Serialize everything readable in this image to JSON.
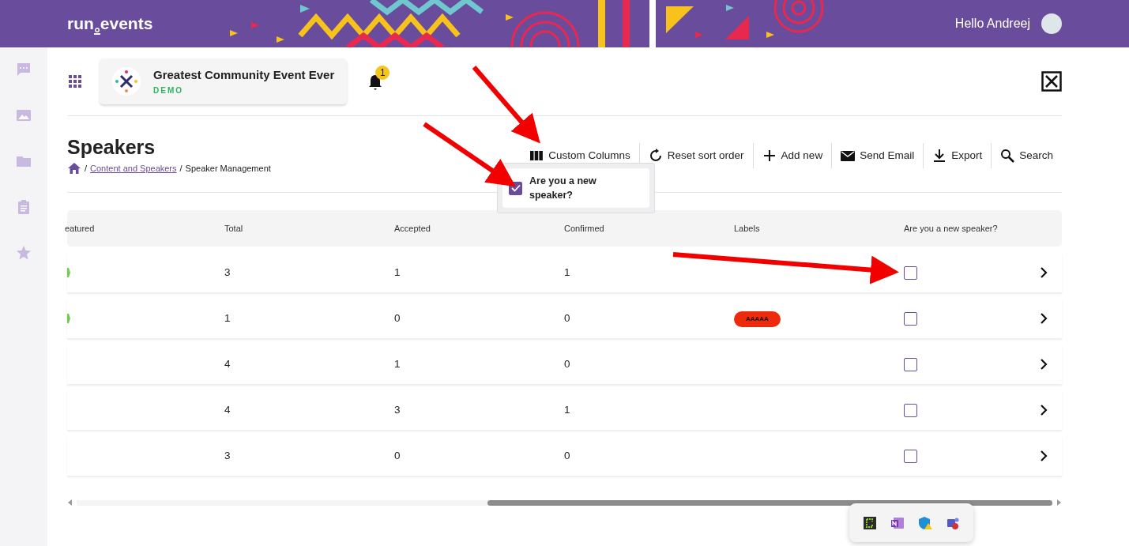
{
  "banner": {
    "logo": [
      "run",
      "events"
    ],
    "greeting": "Hello Andreej"
  },
  "sidebar": {
    "items": [
      {
        "kind": "chat",
        "selected": false
      },
      {
        "kind": "image",
        "selected": false
      },
      {
        "kind": "folder",
        "selected": false
      },
      {
        "kind": "clipboard",
        "selected": false
      },
      {
        "kind": "star",
        "selected": false
      }
    ]
  },
  "event": {
    "title": "Greatest Community Event Ever",
    "tag": "DEMO",
    "notifications": "1"
  },
  "page": {
    "title": "Speakers",
    "breadcrumb": [
      {
        "sep": "/",
        "label": "Content and Speakers",
        "link": true
      },
      {
        "sep": "/",
        "label": "Speaker Management",
        "link": false
      }
    ]
  },
  "toolbar": [
    {
      "kind": "columns",
      "label": "Custom Columns"
    },
    {
      "kind": "reset",
      "label": "Reset sort order"
    },
    {
      "kind": "add",
      "label": "Add new"
    },
    {
      "kind": "mail",
      "label": "Send Email"
    },
    {
      "kind": "export",
      "label": "Export"
    },
    {
      "kind": "search",
      "label": "Search"
    }
  ],
  "column_popover": {
    "options": [
      {
        "label": "Are you a new speaker?",
        "checked": true
      }
    ]
  },
  "table": {
    "columns": [
      "eatured",
      "Total",
      "Accepted",
      "Confirmed",
      "Labels",
      "Are you a new speaker?"
    ],
    "rows": [
      {
        "featured": true,
        "total": "3",
        "accepted": "1",
        "confirmed": "1",
        "labels": [],
        "new_speaker": false
      },
      {
        "featured": true,
        "total": "1",
        "accepted": "0",
        "confirmed": "0",
        "labels": [
          {
            "text": "AAAAA",
            "color": "#ee2a0c"
          }
        ],
        "new_speaker": false
      },
      {
        "featured": false,
        "total": "4",
        "accepted": "1",
        "confirmed": "0",
        "labels": [],
        "new_speaker": false
      },
      {
        "featured": false,
        "total": "4",
        "accepted": "3",
        "confirmed": "1",
        "labels": [],
        "new_speaker": false
      },
      {
        "featured": false,
        "total": "3",
        "accepted": "0",
        "confirmed": "0",
        "labels": [],
        "new_speaker": false
      }
    ]
  },
  "tray": [
    {
      "kind": "terminal"
    },
    {
      "kind": "notes"
    },
    {
      "kind": "shield"
    },
    {
      "kind": "teams"
    }
  ]
}
